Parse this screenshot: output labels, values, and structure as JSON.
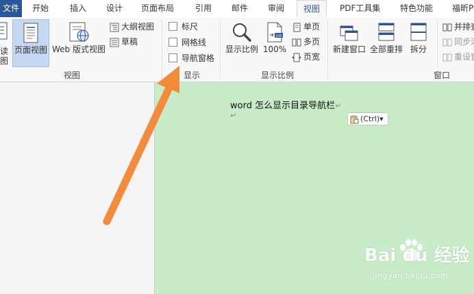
{
  "tabs": {
    "file": "文件",
    "items": [
      "开始",
      "插入",
      "设计",
      "页面布局",
      "引用",
      "邮件",
      "审阅",
      "视图",
      "PDF工具集",
      "特色功能",
      "福昕PD"
    ],
    "active_index": 7
  },
  "ribbon": {
    "view_group": {
      "label": "视图",
      "read_mode": "阅读\n视图",
      "read_mode_top": "读",
      "read_mode_bottom": "图",
      "print_layout": "页面视图",
      "web_layout": "Web 版式视图",
      "outline": "大纲视图",
      "draft": "草稿"
    },
    "show_group": {
      "label": "显示",
      "ruler": "标尺",
      "gridlines": "网格线",
      "nav_pane": "导航窗格"
    },
    "zoom_group": {
      "label": "显示比例",
      "zoom": "显示比例",
      "hundred": "100%",
      "one_page": "单页",
      "multi_page": "多页",
      "page_width": "页宽"
    },
    "window_group": {
      "label": "窗口",
      "new_window": "新建窗口",
      "arrange_all": "全部重排",
      "split": "拆分",
      "side_by_side": "并排查",
      "sync_scroll": "同步滚",
      "reset_pos": "重设窗"
    }
  },
  "document": {
    "line1": "word 怎么显示目录导航栏",
    "para_mark": "↵",
    "paste_label": "(Ctrl)",
    "paste_arrow": "▾"
  },
  "watermark": {
    "main": "Bai du 经验",
    "sub": "jingyan.baidu.com"
  },
  "colors": {
    "accent": "#2b579a",
    "page_bg": "#c8ecc8",
    "arrow": "#f28b3c"
  }
}
